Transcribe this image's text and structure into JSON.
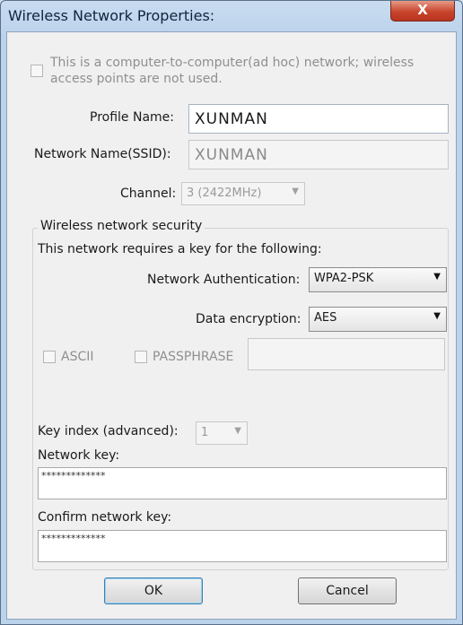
{
  "window": {
    "title": "Wireless Network Properties:",
    "close_label": "X"
  },
  "adhoc": {
    "label_line1": "This is a computer-to-computer(ad hoc) network; wireless",
    "label_line2": "access points are not used.",
    "checked": false
  },
  "profile": {
    "label": "Profile Name:",
    "value": "XUNMAN"
  },
  "ssid": {
    "label": "Network Name(SSID):",
    "value": "XUNMAN"
  },
  "channel": {
    "label": "Channel:",
    "value": "3 (2422MHz)"
  },
  "security": {
    "legend": "Wireless network security",
    "requires_text": "This network requires a key for the following:",
    "auth_label": "Network Authentication:",
    "auth_value": "WPA2-PSK",
    "encryption_label": "Data encryption:",
    "encryption_value": "AES",
    "ascii_label": "ASCII",
    "passphrase_label": "PASSPHRASE",
    "passphrase_value": ""
  },
  "key": {
    "index_label": "Key index (advanced):",
    "index_value": "1",
    "network_key_label": "Network key:",
    "network_key_value": "*************",
    "confirm_label": "Confirm network key:",
    "confirm_value": "*************"
  },
  "buttons": {
    "ok": "OK",
    "cancel": "Cancel"
  }
}
